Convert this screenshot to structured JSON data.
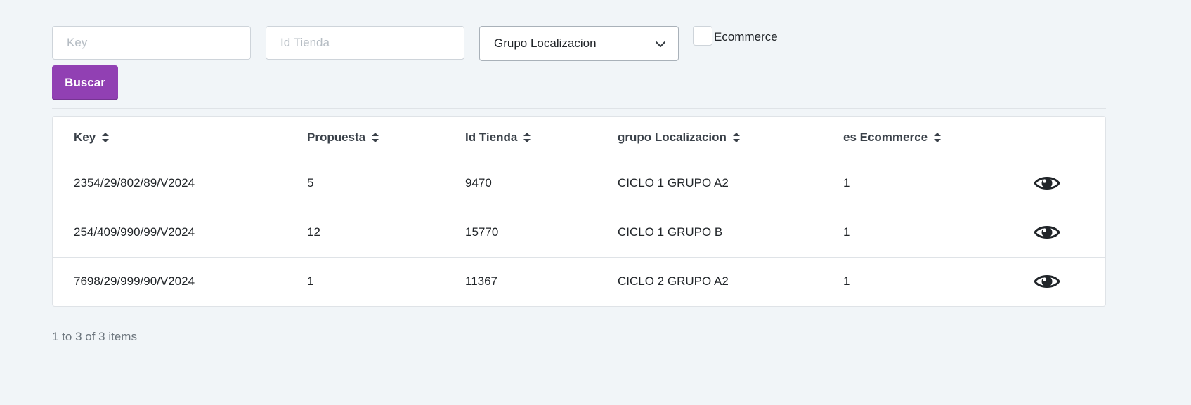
{
  "filters": {
    "key_placeholder": "Key",
    "id_tienda_placeholder": "Id Tienda",
    "grupo_select_value": "Grupo Localizacion",
    "ecommerce_label": "Ecommerce",
    "ecommerce_checked": false,
    "search_label": "Buscar"
  },
  "table": {
    "columns": [
      "Key",
      "Propuesta",
      "Id Tienda",
      "grupo Localizacion",
      "es Ecommerce"
    ],
    "rows": [
      {
        "key": "2354/29/802/89/V2024",
        "propuesta": "5",
        "id_tienda": "9470",
        "grupo": "CICLO 1 GRUPO A2",
        "es_ecommerce": "1"
      },
      {
        "key": "254/409/990/99/V2024",
        "propuesta": "12",
        "id_tienda": "15770",
        "grupo": "CICLO 1 GRUPO B",
        "es_ecommerce": "1"
      },
      {
        "key": "7698/29/999/90/V2024",
        "propuesta": "1",
        "id_tienda": "11367",
        "grupo": "CICLO 2 GRUPO A2",
        "es_ecommerce": "1"
      }
    ],
    "row_action_icon": "eye-icon"
  },
  "pagination": {
    "summary": "1 to 3 of 3 items"
  },
  "colors": {
    "page_background": "#f1f5f8",
    "primary_button": "#9140b3",
    "border": "#dfe3e7"
  }
}
